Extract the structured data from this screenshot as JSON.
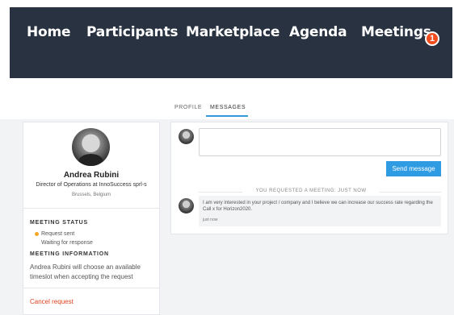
{
  "nav": {
    "items": [
      "Home",
      "Participants",
      "Marketplace",
      "Agenda",
      "Meetings"
    ],
    "meetings_badge": "1"
  },
  "tabs": [
    {
      "label": "PROFILE",
      "active": false
    },
    {
      "label": "MESSAGES",
      "active": true
    }
  ],
  "profile": {
    "name": "Andrea Rubini",
    "title": "Director of Operations at InnoSuccess sprl-s",
    "location": "Brussels, Belgium"
  },
  "meeting": {
    "status_title": "MEETING STATUS",
    "status": "Request sent",
    "status_sub": "Waiting for response",
    "info_title": "MEETING INFORMATION",
    "info_text": "Andrea Rubini will choose an available timeslot when accepting the request",
    "cancel_label": "Cancel request"
  },
  "messages": {
    "input_placeholder": "",
    "send_label": "Send message",
    "request_notice": "YOU REQUESTED A MEETING: JUST NOW",
    "items": [
      {
        "text": "I am very interested in your project / company and I believe we can increase our success rate regarding the Call x for Horizon2020.",
        "time": "just now"
      }
    ]
  },
  "colors": {
    "nav_bg": "#283240",
    "accent": "#2f9be3",
    "badge": "#f04c1e",
    "cancel": "#e0411e",
    "status_dot": "#f5a623"
  }
}
